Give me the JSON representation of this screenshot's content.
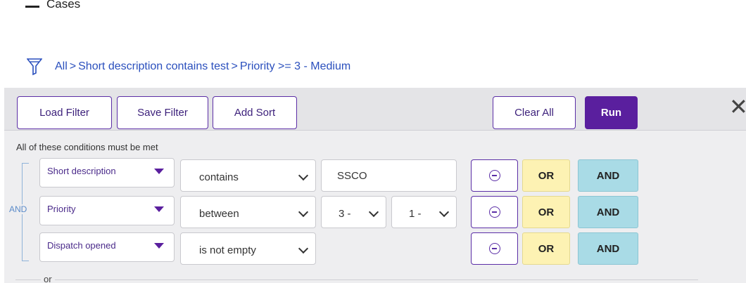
{
  "header": {
    "title": "Cases"
  },
  "breadcrumb": {
    "items": [
      "All",
      "Short description contains test",
      "Priority >= 3 - Medium"
    ],
    "separator": ">"
  },
  "toolbar": {
    "load_filter": "Load Filter",
    "save_filter": "Save Filter",
    "add_sort": "Add Sort",
    "clear_all": "Clear All",
    "run": "Run",
    "close": "✕"
  },
  "conditions": {
    "heading": "All of these conditions must be met",
    "group_operator": "AND",
    "rows": [
      {
        "field": "Short description",
        "operator": "contains",
        "value": "SSCO",
        "or": "OR",
        "and": "AND"
      },
      {
        "field": "Priority",
        "operator": "between",
        "value_from": "3 -",
        "value_to": "1 -",
        "or": "OR",
        "and": "AND"
      },
      {
        "field": "Dispatch opened",
        "operator": "is not empty",
        "or": "OR",
        "and": "AND"
      }
    ],
    "or_divider": "or"
  },
  "colors": {
    "accent": "#5a1f9e",
    "or_button": "#fdf2b3",
    "and_button": "#a9dbe6",
    "link": "#2a4fbd"
  },
  "icons": [
    "menu-icon",
    "filter-funnel-icon",
    "dropdown-caret-icon",
    "chevron-down-icon",
    "remove-condition-icon",
    "close-icon"
  ]
}
